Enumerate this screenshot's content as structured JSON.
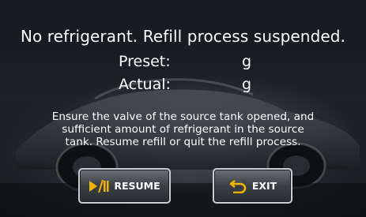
{
  "dialog": {
    "title": "No refrigerant. Refill process suspended.",
    "preset_label": "Preset:",
    "preset_unit": "g",
    "actual_label": "Actual:",
    "actual_unit": "g",
    "message_lines": [
      "Ensure the valve of the source tank opened, and",
      "sufficient amount of refrigerant in the source",
      "tank. Resume refill or quit the refill process."
    ]
  },
  "buttons": {
    "resume_label": "RESUME",
    "exit_label": "EXIT"
  },
  "icons": {
    "resume": "play-pause-icon",
    "exit": "back-arrow-icon"
  },
  "colors": {
    "icon_accent": "#f0b400",
    "text": "#ffffff"
  }
}
